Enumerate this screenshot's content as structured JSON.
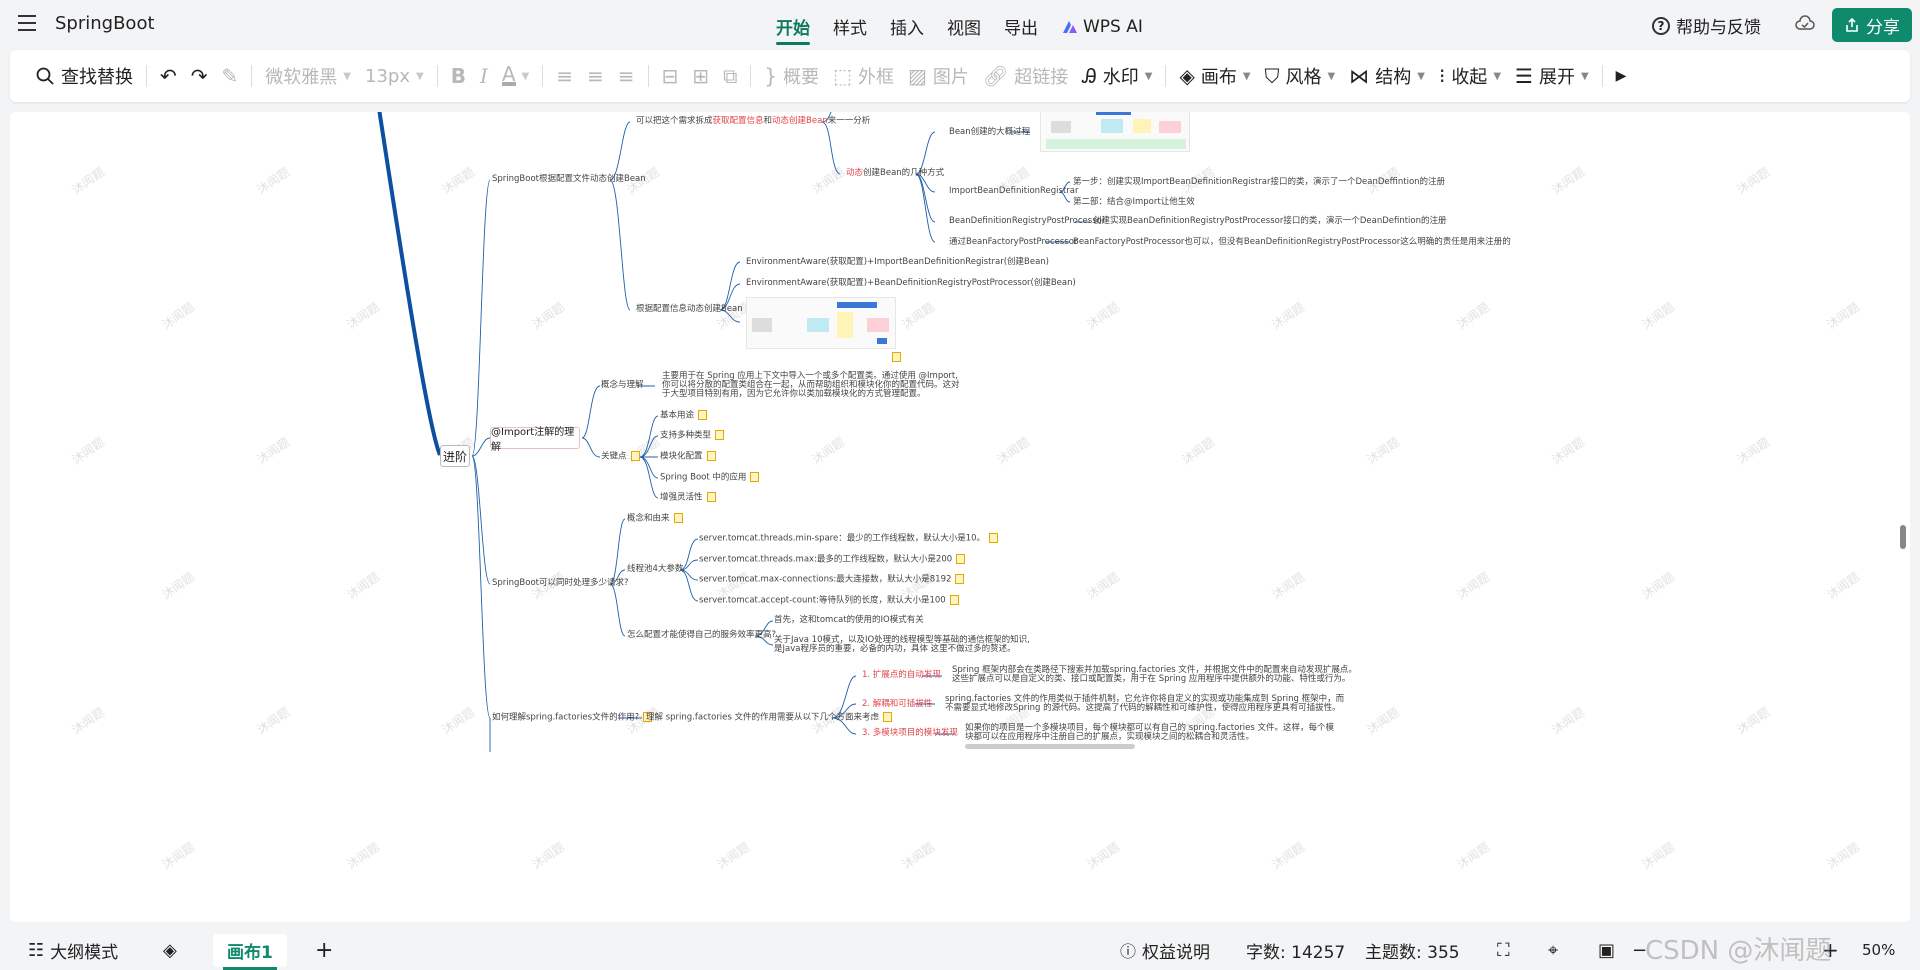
{
  "app": {
    "title": "SpringBoot"
  },
  "main_tabs": [
    "开始",
    "样式",
    "插入",
    "视图",
    "导出"
  ],
  "wps_ai": "WPS AI",
  "header": {
    "help": "帮助与反馈",
    "share": "分享"
  },
  "toolbar": {
    "find_replace": "查找替换",
    "font": "微软雅黑",
    "size": "13px",
    "summary": "概要",
    "outline_frame": "外框",
    "image": "图片",
    "hyperlink": "超链接",
    "watermark": "水印",
    "canvas": "画布",
    "style": "风格",
    "structure": "结构",
    "collapse": "收起",
    "expand": "展开"
  },
  "mindmap": {
    "root": "进阶",
    "n_config_bean": "SpringBoot根据配置文件动态创建Bean",
    "n_split_a": "可以把这个需求拆成",
    "n_split_b": "获取配置信息",
    "n_split_c": "和",
    "n_split_d": "动态创建Bean",
    "n_split_e": "来一一分析",
    "n_dynamic_a": "动态",
    "n_dynamic_b": "创建Bean的几种方式",
    "n_bean_process": "Bean创建的大概过程",
    "n_import_registrar": "ImportBeanDefinitionRegistrar",
    "n_step1": "第一步：创建实现ImportBeanDefinitionRegistrar接口的类，演示了一个DeanDeffintion的注册",
    "n_step2": "第二部：结合@Import让他生效",
    "n_registry_pp": "BeanDefinitionRegistryPostProcessor",
    "n_registry_pp_desc": "创建实现BeanDefinitionRegistryPostProcessor接口的类，演示一个DeanDefintion的注册",
    "n_factory_pp": "通过BeanFactoryPostProcessor",
    "n_factory_pp_desc": "BeanFactoryPostProcessor也可以，但没有BeanDefinitionRegistryPostProcessor这么明确的责任是用来注册的",
    "n_by_config": "根据配置信息动态创建Bean",
    "n_env1": "EnvironmentAware(获取配置)+ImportBeanDefinitionRegistrar(创建Bean)",
    "n_env2": "EnvironmentAware(获取配置)+BeanDefinitionRegistryPostProcessor(创建Bean)",
    "n_import_title": "@Import注解的理解",
    "n_concept": "概念与理解",
    "n_concept_desc1": "主要用于在 Spring 应用上下文中导入一个或多个配置类。通过使用 @Import,",
    "n_concept_desc2": "你可以将分散的配置类组合在一起，从而帮助组织和模块化你的配置代码。这对",
    "n_concept_desc3": "于大型项目特别有用，因为它允许你以类加载模块化的方式管理配置。",
    "n_keypoints": "关键点",
    "n_kp1": "基本用途",
    "n_kp2": "支持多种类型",
    "n_kp3": "模块化配置",
    "n_kp4": "Spring Boot 中的应用",
    "n_kp5": "增强灵活性",
    "n_concurrency": "SpringBoot可以同时处理多少请求?",
    "n_cc_concept": "概念和由来",
    "n_threads": "线程池4大参数",
    "n_t1": "server.tomcat.threads.min-spare：最少的工作线程数，默认大小是10。",
    "n_t2": "server.tomcat.threads.max:最多的工作线程数，默认大小是200",
    "n_t3": "server.tomcat.max-connections:最大连接数，默认大小是8192",
    "n_t4": "server.tomcat.accept-count:等待队列的长度，默认大小是100",
    "n_howto": "怎么配置才能使得自己的服务效率更高?",
    "n_howto1": "首先，这和tomcat的使用的IO模式有关",
    "n_howto2a": "关于Java 10模式，以及IO处理的线程模型等基础的通信框架的知识,",
    "n_howto2b": "是Java程序员的重要，必备的内功，具体 这里不做过多的赘述。",
    "n_factories": "如何理解spring.factories文件的作用?",
    "n_factories_sub": "理解 spring.factories 文件的作用需要从以下几个方面来考虑",
    "n_f1": "1. 扩展点的自动发现",
    "n_f1_desc1": "Spring 框架内部会在类路径下搜索并加载spring.factories 文件，并根据文件中的配置来自动发现扩展点。",
    "n_f1_desc2": "这些扩展点可以是自定义的类、接口或配置类，用于在 Spring 应用程序中提供额外的功能、特性或行为。",
    "n_f2": "2. 解耦和可插拔性",
    "n_f2_desc1": "spring.factories 文件的作用类似于插件机制，它允许你将自定义的实现或功能集成到 Spring 框架中，而",
    "n_f2_desc2": "不需要显式地修改Spring 的源代码。这提高了代码的解耦性和可维护性，使得应用程序更具有可插拔性。",
    "n_f3": "3. 多模块项目的模块发现",
    "n_f3_desc1": "如果你的项目是一个多模块项目，每个模块都可以有自己的 spring.factories 文件。这样，每个模",
    "n_f3_desc2": "块都可以在应用程序中注册自己的扩展点，实现模块之间的松耦合和灵活性。"
  },
  "watermark_text": "沐闻题",
  "statusbar": {
    "outline": "大纲模式",
    "canvas_tab": "画布1",
    "rights": "权益说明",
    "word_count": "字数: 14257",
    "topic_count": "主题数: 355",
    "zoom": "50%"
  },
  "overlay_watermark": "CSDN @沐闻题",
  "colors": {
    "accent": "#0f8a6c",
    "branch": "#1f5fa8",
    "red": "#e0454b"
  }
}
